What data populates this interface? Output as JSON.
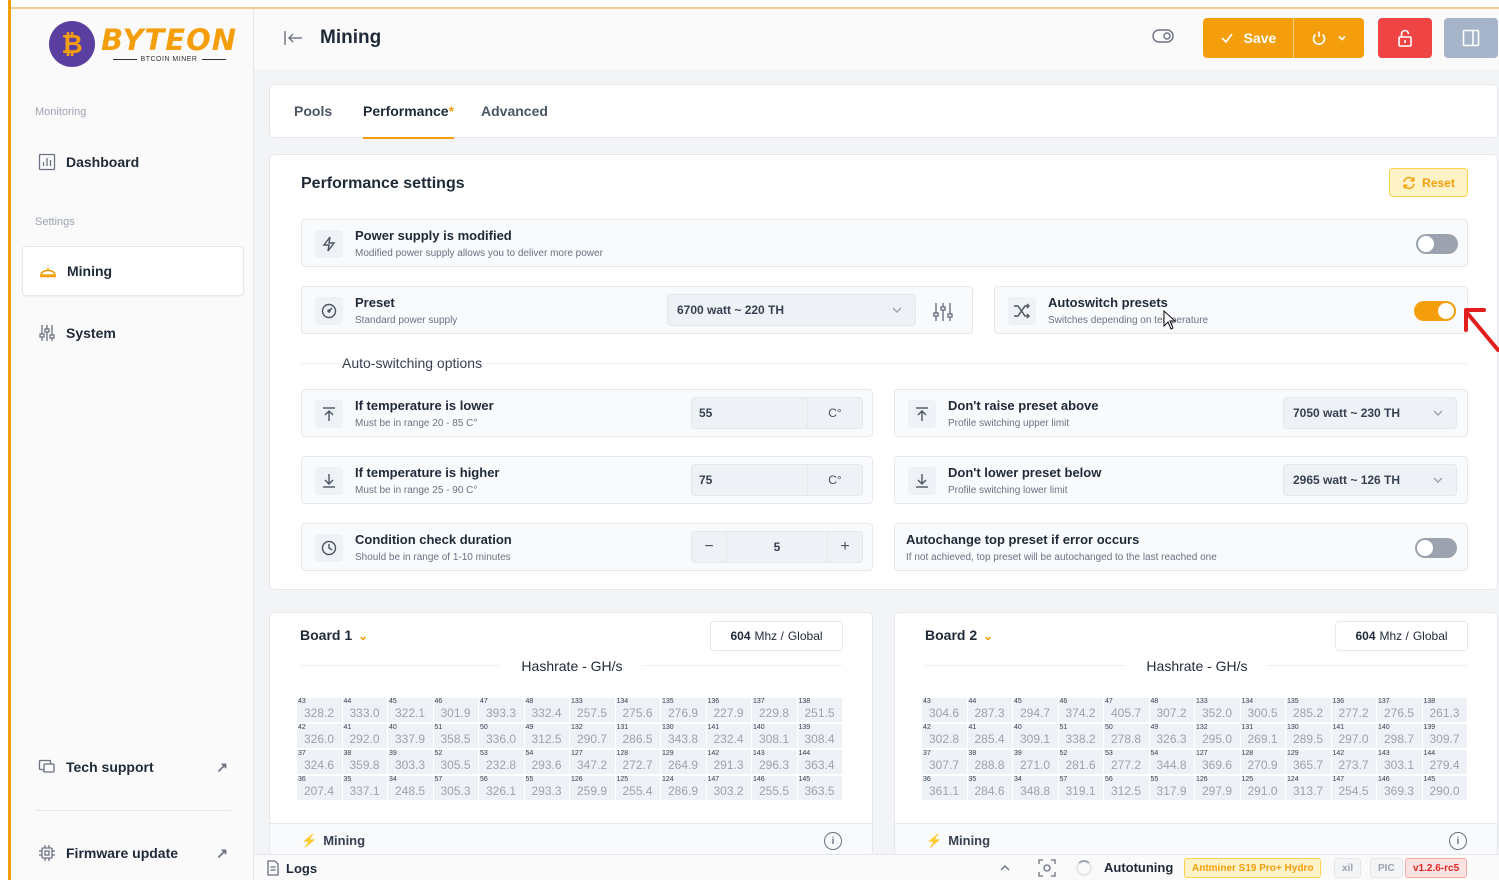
{
  "app": {
    "brand": "BYTEON",
    "brand_sub": "BTCOIN MINER",
    "logo_glyph": "₿"
  },
  "sidebar": {
    "section_monitoring": "Monitoring",
    "section_settings": "Settings",
    "items": [
      {
        "label": "Dashboard",
        "icon": "chart-icon"
      },
      {
        "label": "Mining",
        "icon": "mining-icon"
      },
      {
        "label": "System",
        "icon": "sliders-icon"
      },
      {
        "label": "Tech support",
        "icon": "chat-icon"
      },
      {
        "label": "Firmware update",
        "icon": "chip-icon"
      }
    ]
  },
  "header": {
    "title": "Mining",
    "save_label": "Save"
  },
  "tabs": [
    {
      "label": "Pools"
    },
    {
      "label": "Performance",
      "marker": "*"
    },
    {
      "label": "Advanced"
    }
  ],
  "settings": {
    "title": "Performance settings",
    "reset_label": "Reset",
    "power_supply": {
      "title": "Power supply is modified",
      "subtitle": "Modified power supply allows you to deliver more power",
      "enabled": false
    },
    "preset": {
      "title": "Preset",
      "subtitle": "Standard power supply",
      "value": "6700 watt ~ 220 TH"
    },
    "autoswitch": {
      "title": "Autoswitch presets",
      "subtitle": "Switches depending on temperature",
      "enabled": true
    },
    "autoswitch_label": "Auto-switching options",
    "temp_lower": {
      "title": "If temperature is lower",
      "subtitle": "Must be in range 20 - 85 C°",
      "value": "55",
      "unit": "C°"
    },
    "temp_higher": {
      "title": "If temperature is higher",
      "subtitle": "Must be in range 25 - 90 C°",
      "value": "75",
      "unit": "C°"
    },
    "condition": {
      "title": "Condition check duration",
      "subtitle": "Should be in range of 1-10 minutes",
      "value": "5",
      "minus": "−",
      "plus": "+"
    },
    "raise_above": {
      "title": "Don't raise preset above",
      "subtitle": "Profile switching upper limit",
      "value": "7050 watt ~ 230 TH"
    },
    "lower_below": {
      "title": "Don't lower preset below",
      "subtitle": "Profile switching lower limit",
      "value": "2965 watt ~ 126 TH"
    },
    "autochange": {
      "title": "Autochange top preset if error occurs",
      "subtitle": "If not achieved, top preset will be autochanged to the last reached one",
      "enabled": false
    }
  },
  "boards": [
    {
      "title": "Board 1",
      "freq": "604",
      "freq_unit": "Mhz /",
      "freq_scope": "Global",
      "subtitle": "Hashrate - GH/s",
      "status": "Mining",
      "rows": [
        [
          [
            "43",
            "328.2"
          ],
          [
            "44",
            "333.0"
          ],
          [
            "45",
            "322.1"
          ],
          [
            "46",
            "301.9"
          ],
          [
            "47",
            "393.3"
          ],
          [
            "48",
            "332.4"
          ],
          [
            "133",
            "257.5"
          ],
          [
            "134",
            "275.6"
          ],
          [
            "135",
            "276.9"
          ],
          [
            "136",
            "227.9"
          ],
          [
            "137",
            "229.8"
          ],
          [
            "138",
            "251.5"
          ]
        ],
        [
          [
            "42",
            "326.0"
          ],
          [
            "41",
            "292.0"
          ],
          [
            "40",
            "337.9"
          ],
          [
            "51",
            "358.5"
          ],
          [
            "50",
            "336.0"
          ],
          [
            "49",
            "312.5"
          ],
          [
            "132",
            "290.7"
          ],
          [
            "131",
            "286.5"
          ],
          [
            "130",
            "343.8"
          ],
          [
            "141",
            "232.4"
          ],
          [
            "140",
            "308.1"
          ],
          [
            "139",
            "308.4"
          ]
        ],
        [
          [
            "37",
            "324.6"
          ],
          [
            "38",
            "359.8"
          ],
          [
            "39",
            "303.3"
          ],
          [
            "52",
            "305.5"
          ],
          [
            "53",
            "232.8"
          ],
          [
            "54",
            "293.6"
          ],
          [
            "127",
            "347.2"
          ],
          [
            "128",
            "272.7"
          ],
          [
            "129",
            "264.9"
          ],
          [
            "142",
            "291.3"
          ],
          [
            "143",
            "296.3"
          ],
          [
            "144",
            "363.4"
          ]
        ],
        [
          [
            "36",
            "207.4"
          ],
          [
            "35",
            "337.1"
          ],
          [
            "34",
            "248.5"
          ],
          [
            "57",
            "305.3"
          ],
          [
            "56",
            "326.1"
          ],
          [
            "55",
            "293.3"
          ],
          [
            "126",
            "259.9"
          ],
          [
            "125",
            "255.4"
          ],
          [
            "124",
            "286.9"
          ],
          [
            "147",
            "303.2"
          ],
          [
            "146",
            "255.5"
          ],
          [
            "145",
            "363.5"
          ]
        ]
      ]
    },
    {
      "title": "Board 2",
      "freq": "604",
      "freq_unit": "Mhz /",
      "freq_scope": "Global",
      "subtitle": "Hashrate - GH/s",
      "status": "Mining",
      "rows": [
        [
          [
            "43",
            "304.6"
          ],
          [
            "44",
            "287.3"
          ],
          [
            "45",
            "294.7"
          ],
          [
            "46",
            "374.2"
          ],
          [
            "47",
            "405.7"
          ],
          [
            "48",
            "307.2"
          ],
          [
            "133",
            "352.0"
          ],
          [
            "134",
            "300.5"
          ],
          [
            "135",
            "285.2"
          ],
          [
            "136",
            "277.2"
          ],
          [
            "137",
            "276.5"
          ],
          [
            "138",
            "261.3"
          ]
        ],
        [
          [
            "42",
            "302.8"
          ],
          [
            "41",
            "285.4"
          ],
          [
            "40",
            "309.1"
          ],
          [
            "51",
            "338.2"
          ],
          [
            "50",
            "278.8"
          ],
          [
            "49",
            "326.3"
          ],
          [
            "132",
            "295.0"
          ],
          [
            "131",
            "269.1"
          ],
          [
            "130",
            "289.5"
          ],
          [
            "141",
            "297.0"
          ],
          [
            "140",
            "298.7"
          ],
          [
            "139",
            "309.7"
          ]
        ],
        [
          [
            "37",
            "307.7"
          ],
          [
            "38",
            "288.8"
          ],
          [
            "39",
            "271.0"
          ],
          [
            "52",
            "281.6"
          ],
          [
            "53",
            "277.2"
          ],
          [
            "54",
            "344.8"
          ],
          [
            "127",
            "369.6"
          ],
          [
            "128",
            "270.9"
          ],
          [
            "129",
            "365.7"
          ],
          [
            "142",
            "273.7"
          ],
          [
            "143",
            "303.1"
          ],
          [
            "144",
            "279.4"
          ]
        ],
        [
          [
            "36",
            "361.1"
          ],
          [
            "35",
            "284.6"
          ],
          [
            "34",
            "348.8"
          ],
          [
            "57",
            "319.1"
          ],
          [
            "56",
            "312.5"
          ],
          [
            "55",
            "317.9"
          ],
          [
            "126",
            "297.9"
          ],
          [
            "125",
            "291.0"
          ],
          [
            "124",
            "313.7"
          ],
          [
            "147",
            "254.5"
          ],
          [
            "146",
            "369.3"
          ],
          [
            "145",
            "290.0"
          ]
        ]
      ]
    }
  ],
  "footer": {
    "logs": "Logs",
    "autotuning": "Autotuning",
    "model": "Antminer S19 Pro+ Hydro",
    "badge_xil": "xil",
    "badge_pic": "PIC",
    "version": "v1.2.6-rc5"
  },
  "colors": {
    "accent": "#f59e0b",
    "danger": "#ef4444",
    "brand_purple": "#5b3fa0"
  }
}
